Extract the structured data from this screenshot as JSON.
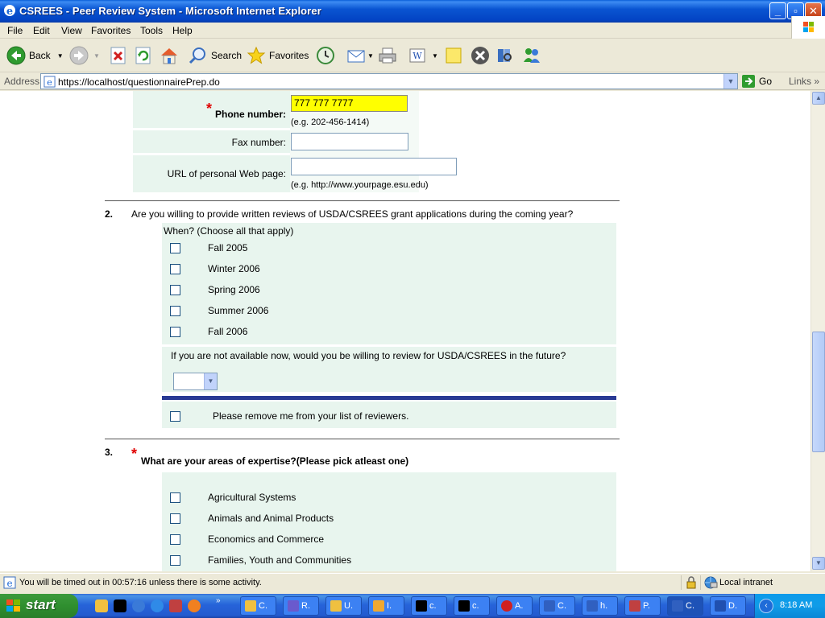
{
  "window": {
    "title": "CSREES - Peer Review System - Microsoft Internet Explorer"
  },
  "menu": {
    "items": [
      "File",
      "Edit",
      "View",
      "Favorites",
      "Tools",
      "Help"
    ]
  },
  "toolbar": {
    "back": "Back",
    "search": "Search",
    "favorites": "Favorites"
  },
  "address": {
    "label": "Address",
    "url": "https://localhost/questionnairePrep.do",
    "go": "Go",
    "links": "Links"
  },
  "form": {
    "phone_label": "Phone number:",
    "phone_value": "777 777 7777",
    "phone_hint": "(e.g. 202-456-1414)",
    "fax_label": "Fax number:",
    "fax_value": "",
    "url_label": "URL of personal Web page:",
    "url_value": "",
    "url_hint": "(e.g. http://www.yourpage.esu.edu)",
    "required_mark": "*"
  },
  "q2": {
    "number": "2.",
    "text": "Are you willing to provide written reviews of USDA/CSREES grant applications during the coming year?",
    "when_label": "When? (Choose all that apply)",
    "options": [
      "Fall 2005",
      "Winter 2006",
      "Spring 2006",
      "Summer 2006",
      "Fall 2006"
    ],
    "future_text": "If you are not available now, would you be willing to review for USDA/CSREES in the future?",
    "future_selected": "",
    "remove_label": "Please remove me from your list of reviewers."
  },
  "q3": {
    "number": "3.",
    "text_bold": "What are your areas of expertise?",
    "text_rest": "(Please pick atleast one)",
    "options": [
      "Agricultural Systems",
      "Animals and Animal Products",
      "Economics and Commerce",
      "Families, Youth and Communities"
    ]
  },
  "status": {
    "message": "You will be timed out in 00:57:16 unless there is some activity.",
    "zone": "Local intranet"
  },
  "taskbar": {
    "start": "start",
    "tasks": [
      {
        "label": "C.",
        "color": "#f0c040"
      },
      {
        "label": "R.",
        "color": "#6a5acd"
      },
      {
        "label": "U.",
        "color": "#f0c040"
      },
      {
        "label": "I.",
        "color": "#f0a830"
      },
      {
        "label": "c.",
        "color": "#000000"
      },
      {
        "label": "c.",
        "color": "#000000"
      },
      {
        "label": "A.",
        "color": "#d02020"
      },
      {
        "label": "C.",
        "color": "#3060c0"
      },
      {
        "label": "h.",
        "color": "#3060c0"
      },
      {
        "label": "P.",
        "color": "#c04040"
      },
      {
        "label": "C.",
        "color": "#3060c0"
      },
      {
        "label": "D.",
        "color": "#2050b0"
      }
    ],
    "clock": "8:18 AM"
  }
}
